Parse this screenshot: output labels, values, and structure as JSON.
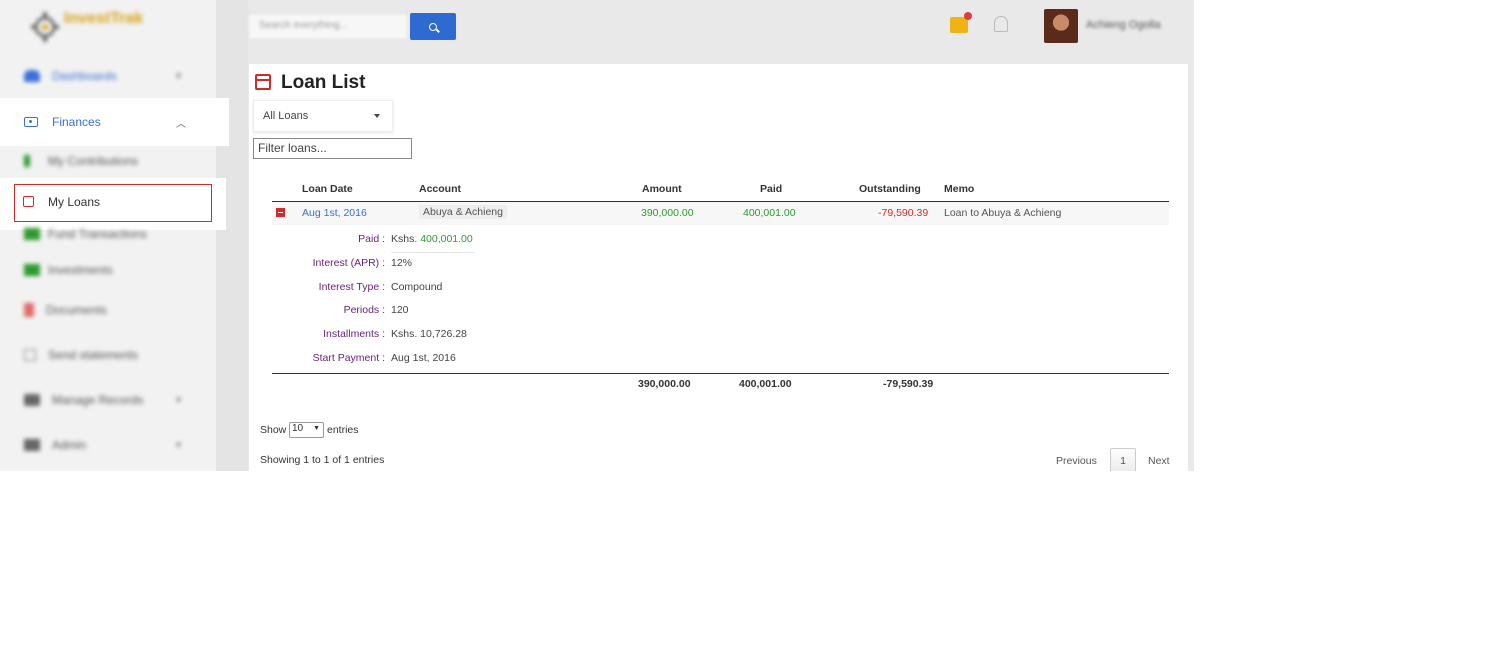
{
  "sidebar": {
    "brand": "InvestTrak",
    "items": [
      {
        "label": "Dashboards"
      },
      {
        "label": "Finances"
      },
      {
        "label": "My Contributions"
      },
      {
        "label": "My Loans"
      },
      {
        "label": "Fund Transactions"
      },
      {
        "label": "Investments"
      },
      {
        "label": "Documents"
      },
      {
        "label": "Send statements"
      },
      {
        "label": "Manage Records"
      },
      {
        "label": "Admin"
      }
    ]
  },
  "topbar": {
    "search_placeholder": "Search everything...",
    "user_name": "Achieng Ogolla"
  },
  "page": {
    "title": "Loan List",
    "loan_filter_select": "All Loans",
    "filter_placeholder": "Filter loans..."
  },
  "table": {
    "columns": [
      "Loan Date",
      "Account",
      "Amount",
      "Paid",
      "Outstanding",
      "Memo"
    ],
    "rows": [
      {
        "date": "Aug 1st, 2016",
        "account": "Abuya & Achieng",
        "amount": "390,000.00",
        "paid": "400,001.00",
        "outstanding": "-79,590.39",
        "memo": "Loan to Abuya & Achieng"
      }
    ],
    "details": [
      {
        "key": "Paid :",
        "prefix": "Kshs.",
        "value": "400,001.00"
      },
      {
        "key": "Interest (APR) :",
        "value": "12%"
      },
      {
        "key": "Interest Type :",
        "value": "Compound"
      },
      {
        "key": "Periods :",
        "value": "120"
      },
      {
        "key": "Installments :",
        "value": "Kshs. 10,726.28"
      },
      {
        "key": "Start Payment :",
        "value": "Aug 1st, 2016"
      }
    ],
    "totals": {
      "amount": "390,000.00",
      "paid": "400,001.00",
      "outstanding": "-79,590.39"
    }
  },
  "footer": {
    "show_label": "Show",
    "page_length": "10",
    "entries_label": "entries",
    "info": "Showing 1 to 1 of 1 entries",
    "previous": "Previous",
    "current_page": "1",
    "next": "Next"
  },
  "colors": {
    "accent_blue": "#3a6fd6",
    "danger_red": "#d12a2a",
    "success_green": "#2e9a2e",
    "label_purple": "#6a1e7a"
  }
}
